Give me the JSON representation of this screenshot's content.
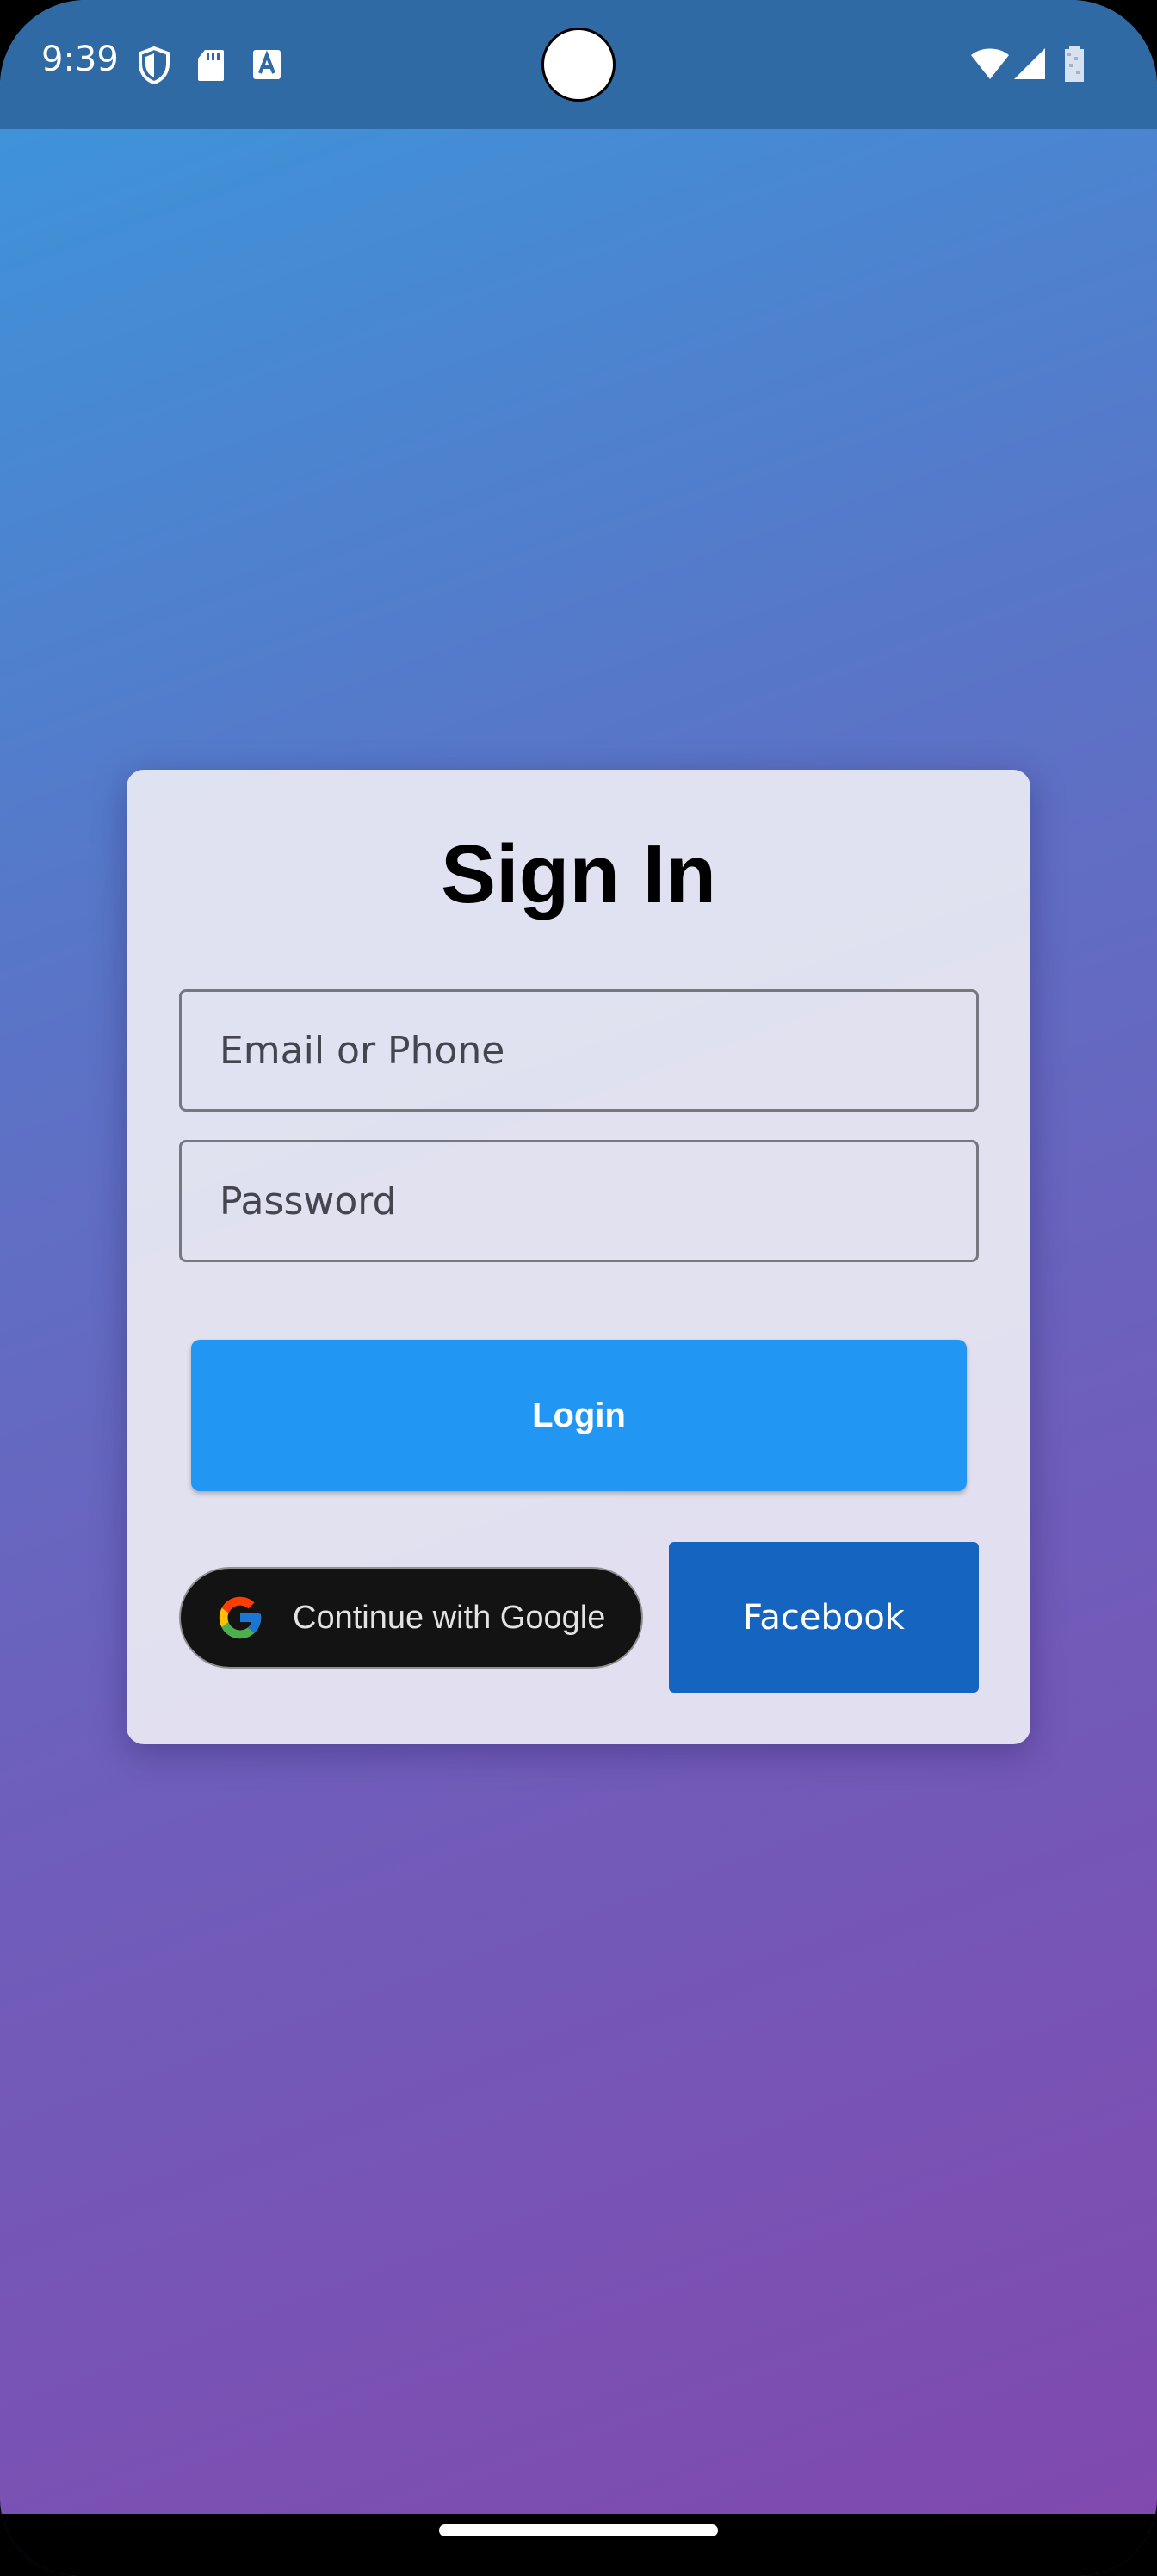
{
  "status_bar": {
    "time": "9:39",
    "icons": [
      "shield-icon",
      "sd-card-icon",
      "font-a-icon"
    ],
    "right_icons": [
      "wifi-icon",
      "cellular-signal-icon",
      "battery-icon"
    ]
  },
  "signin": {
    "title": "Sign In",
    "email_placeholder": "Email or Phone",
    "password_placeholder": "Password",
    "login_label": "Login",
    "google_label": "Continue with Google",
    "facebook_label": "Facebook"
  },
  "colors": {
    "status_bar": "#2f6aa4",
    "gradient_top": "#3a98dc",
    "gradient_bottom": "#8148ae",
    "login_button": "#2196f3",
    "facebook_button": "#1565c0",
    "google_button": "#131314"
  }
}
